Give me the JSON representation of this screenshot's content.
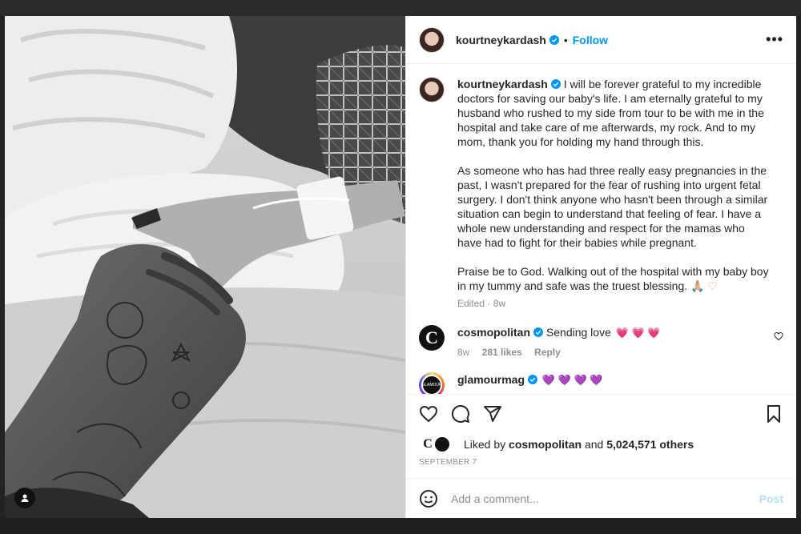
{
  "post": {
    "username": "kourtneykardash",
    "follow_label": "Follow",
    "separator": "•",
    "more_label": "•••",
    "caption_paragraphs": [
      "I will be forever grateful to my incredible doctors for saving our baby's life. I am eternally grateful to my husband who rushed to my side from tour to be with me in the hospital and take care of me afterwards, my rock. And to my mom, thank you for holding my hand through this.",
      "As someone who has had three really easy pregnancies in the past, I wasn't prepared for the fear of rushing into urgent fetal surgery. I don't think anyone who hasn't been through a similar situation can begin to understand that feeling of fear. I have a whole new understanding and respect for the mamas who have had to fight for their babies while pregnant.",
      "Praise be to God. Walking out of the hospital with my baby boy in my tummy and safe was the truest blessing."
    ],
    "caption_emoji": "🙏🏼 ♡",
    "caption_meta": "Edited · 8w"
  },
  "comments": [
    {
      "username": "cosmopolitan",
      "avatar_letter": "C",
      "text": "Sending love",
      "emoji": "💗 💗 💗",
      "age": "8w",
      "likes": "281 likes",
      "reply_label": "Reply"
    },
    {
      "username": "glamourmag",
      "avatar_text": "GLAMOUR",
      "emoji": "💜 💜 💜 💜"
    }
  ],
  "likes": {
    "prefix": "Liked by",
    "user": "cosmopolitan",
    "connector": "and",
    "count": "5,024,571 others",
    "mini_avatar_letter": "C"
  },
  "date": "September 7",
  "comment_box": {
    "placeholder": "Add a comment...",
    "post_label": "Post"
  },
  "colors": {
    "link_blue": "#0095f6",
    "post_disabled": "#b2dffc",
    "verified_blue": "#0095f6",
    "muted": "#8e8e8e"
  },
  "icons": [
    "verified-icon",
    "more-icon",
    "heart-icon",
    "comment-icon",
    "share-icon",
    "bookmark-icon",
    "emoji-icon",
    "user-tag-icon"
  ]
}
